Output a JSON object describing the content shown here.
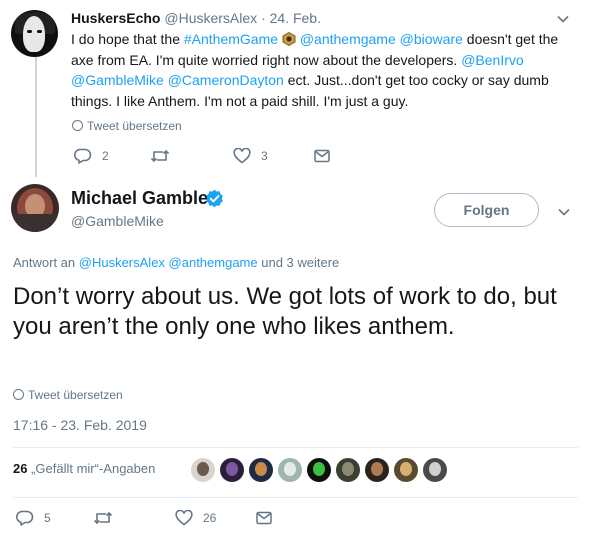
{
  "parent_tweet": {
    "display_name": "HuskersEcho",
    "handle": "@HuskersAlex",
    "date": "· 24. Feb.",
    "text_parts": {
      "t1": "I do hope that the ",
      "t2": "#AnthemGame",
      "t3": " ",
      "t4": " ",
      "t5": "@anthemgame",
      "t6": " ",
      "t7": "@bioware",
      "t8": " doesn't get the axe from EA. I'm quite worried right now about the developers. ",
      "t9": "@BenIrvo",
      "t10": "@GambleMike",
      "t11": " ",
      "t12": "@CameronDayton",
      "t13": " ect. Just...don't get too cocky or say dumb things. I like Anthem. I'm not a paid shill. I'm just a guy."
    },
    "translate_label": "Tweet übersetzen",
    "replies": "2",
    "retweets": "",
    "likes": "3"
  },
  "main_tweet": {
    "display_name": "Michael Gamble",
    "handle": "@GambleMike",
    "follow_label": "Folgen",
    "reply_to_prefix": "Antwort an ",
    "reply_to_users": "@HuskersAlex @anthemgame",
    "reply_to_suffix": " und 3 weitere",
    "text": "Don’t worry about us. We got lots of work to do, but you aren’t the only one who likes anthem.",
    "translate_label": "Tweet übersetzen",
    "timestamp": "17:16 - 23. Feb. 2019",
    "like_count": "26",
    "like_label": " „Gefällt mir“-Angaben",
    "replies": "5",
    "retweets": "",
    "likes": "26"
  },
  "colors": {
    "link": "#1da1f2",
    "muted": "#657786",
    "verified": "#1da1f2",
    "separator": "#e6ecf0"
  },
  "icons": [
    "caret-down-icon",
    "globe-icon",
    "reply-icon",
    "retweet-icon",
    "heart-icon",
    "message-icon",
    "verified-badge-icon",
    "anthem-emoji-icon"
  ]
}
